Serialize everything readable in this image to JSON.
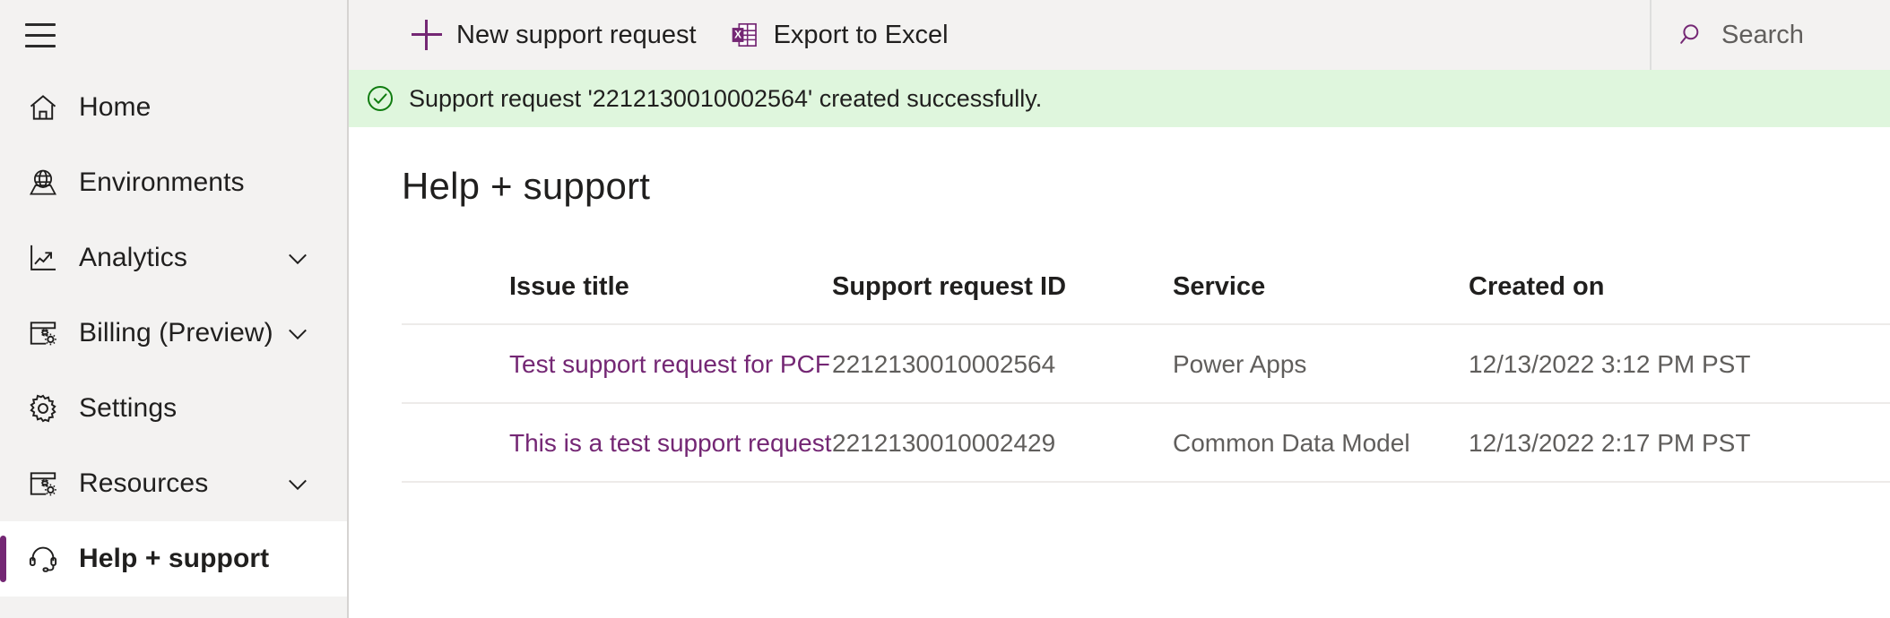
{
  "colors": {
    "accent": "#742774",
    "sidebar_bg": "#f3f2f1",
    "notification_bg": "#dff6dd",
    "notification_icon": "#107c10",
    "text": "#201f1e",
    "muted_text": "#605e5c",
    "divider": "#edebe9"
  },
  "sidebar": {
    "menu_toggle_name": "hamburger-menu",
    "items": [
      {
        "label": "Home",
        "icon": "home-icon",
        "expandable": false,
        "selected": false
      },
      {
        "label": "Environments",
        "icon": "globe-icon",
        "expandable": false,
        "selected": false
      },
      {
        "label": "Analytics",
        "icon": "analytics-icon",
        "expandable": true,
        "selected": false
      },
      {
        "label": "Billing (Preview)",
        "icon": "billing-icon",
        "expandable": true,
        "selected": false
      },
      {
        "label": "Settings",
        "icon": "gear-icon",
        "expandable": false,
        "selected": false
      },
      {
        "label": "Resources",
        "icon": "resources-icon",
        "expandable": true,
        "selected": false
      },
      {
        "label": "Help + support",
        "icon": "headset-icon",
        "expandable": false,
        "selected": true
      }
    ]
  },
  "commandbar": {
    "new_request_label": "New support request",
    "export_label": "Export to Excel"
  },
  "search": {
    "label": "Search",
    "placeholder": "Search"
  },
  "notification": {
    "message": "Support request '2212130010002564' created successfully.",
    "type": "success"
  },
  "page": {
    "title": "Help + support"
  },
  "table": {
    "headers": [
      "Issue title",
      "Support request ID",
      "Service",
      "Created on"
    ],
    "rows": [
      {
        "issue_title": "Test support request for PCF",
        "support_request_id": "2212130010002564",
        "service": "Power Apps",
        "created_on": "12/13/2022 3:12 PM PST"
      },
      {
        "issue_title": "This is a test support request",
        "support_request_id": "2212130010002429",
        "service": "Common Data Model",
        "created_on": "12/13/2022 2:17 PM PST"
      }
    ]
  }
}
